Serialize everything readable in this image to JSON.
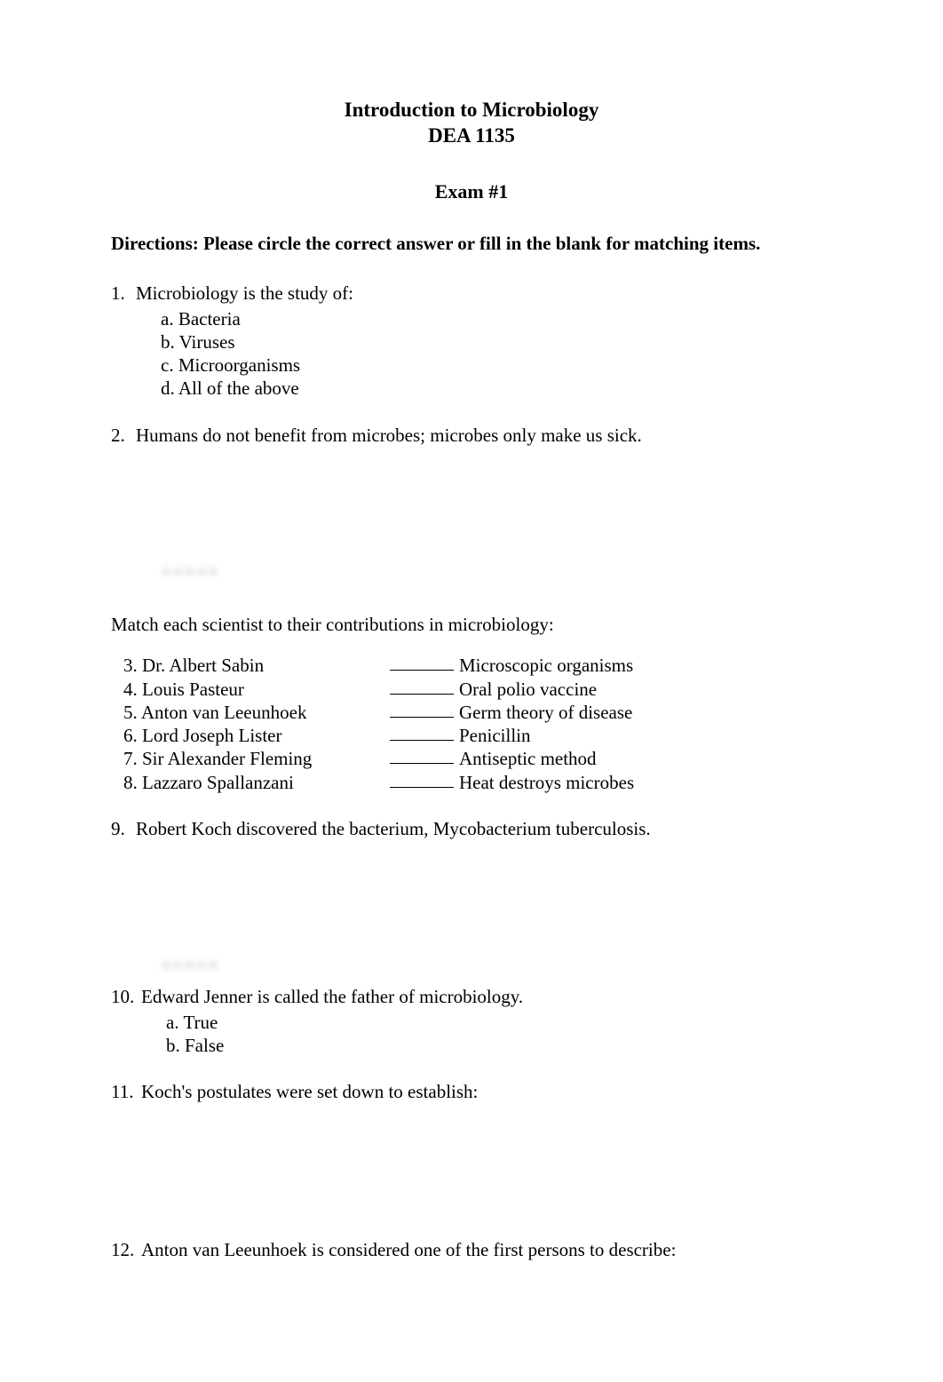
{
  "header": {
    "title": "Introduction to Microbiology",
    "course": "DEA 1135",
    "exam": "Exam #1"
  },
  "directions": "Directions: Please circle the correct answer or fill in the blank for matching items.",
  "q1": {
    "num": "1.",
    "text": "Microbiology is the study of:",
    "a": "a. Bacteria",
    "b": "b. Viruses",
    "c": "c. Microorganisms",
    "d": "d. All of the above"
  },
  "q2": {
    "num": "2.",
    "text": "Humans do not benefit from microbes; microbes only make us sick."
  },
  "match_intro": "Match each scientist to their contributions in microbiology:",
  "match": {
    "left": {
      "r3": "3. Dr. Albert Sabin",
      "r4": "4. Louis Pasteur",
      "r5": "5. Anton van Leeunhoek",
      "r6": "6. Lord Joseph Lister",
      "r7": "7. Sir Alexander Fleming",
      "r8": "8. Lazzaro Spallanzani"
    },
    "right": {
      "r3": "Microscopic organisms",
      "r4": "Oral polio vaccine",
      "r5": "Germ theory of disease",
      "r6": "Penicillin",
      "r7": "Antiseptic method",
      "r8": "Heat destroys microbes"
    }
  },
  "q9": {
    "num": "9.",
    "text": "Robert Koch discovered the bacterium, Mycobacterium tuberculosis."
  },
  "q10": {
    "num": "10.",
    "text": "Edward Jenner is called the father of microbiology.",
    "a": "a. True",
    "b": "b. False"
  },
  "q11": {
    "num": "11.",
    "text": "Koch's postulates were set down to establish:"
  },
  "q12": {
    "num": "12.",
    "text": "Anton van Leeunhoek is considered one of the first persons to describe:"
  }
}
